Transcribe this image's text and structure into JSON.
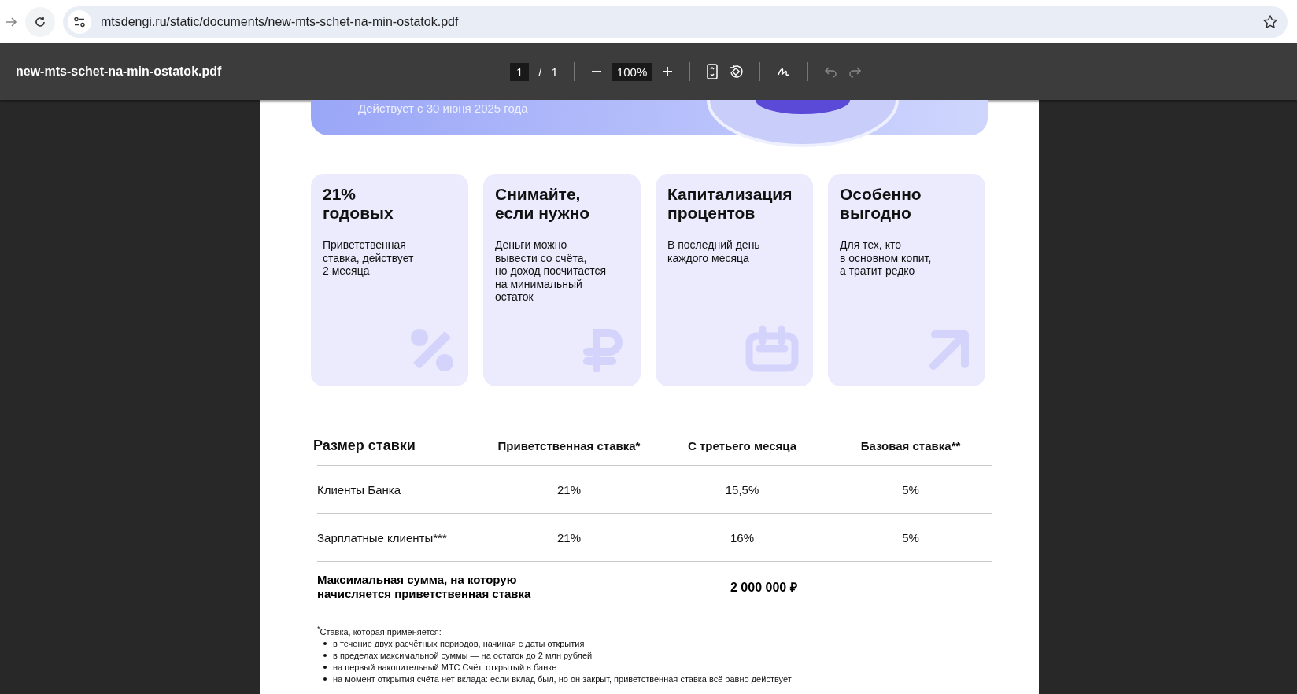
{
  "browser": {
    "url": "mtsdengi.ru/static/documents/new-mts-schet-na-min-ostatok.pdf"
  },
  "pdf_toolbar": {
    "title": "new-mts-schet-na-min-ostatok.pdf",
    "page": "1",
    "page_separator": "/",
    "page_count": "1",
    "zoom": "100%"
  },
  "banner": {
    "subtitle": "Действует с 30 июня 2025 года"
  },
  "cards": [
    {
      "kind": "percent",
      "title": "21%\nгодовых",
      "text": "Приветственная\nставка, действует\n2 месяца"
    },
    {
      "kind": "ruble",
      "title": "Снимайте,\nесли нужно",
      "text": "Деньги можно\nвывести со счёта,\nно доход посчитается\nна минимальный\nостаток"
    },
    {
      "kind": "calendar",
      "title": "Капитализация\nпроцентов",
      "text": "В последний день\nкаждого месяца"
    },
    {
      "kind": "arrow",
      "title": "Особенно\nвыгодно",
      "text": "Для тех, кто\nв основном копит,\nа тратит редко"
    }
  ],
  "table": {
    "columns": [
      "Размер ставки",
      "Приветственная ставка*",
      "С третьего месяца",
      "Базовая ставка**"
    ],
    "rows": [
      [
        "Клиенты Банка",
        "21%",
        "15,5%",
        "5%"
      ],
      [
        "Зарплатные клиенты***",
        "21%",
        "16%",
        "5%"
      ]
    ],
    "max_sum": {
      "label": "Максимальная сумма, на которую\nначисляется приветственная ставка",
      "value": "2 000 000 ₽"
    }
  },
  "footnote": {
    "title": "$^{*}$Ставка, которая применяется:",
    "items": [
      "в течение двух расчётных периодов, начиная с даты открытия",
      "в пределах максимальной суммы — на остаток до 2 млн рублей",
      "на первый накопительный МТС Счёт, открытый в банке",
      "на момент открытия счёта нет вклада: если вклад был, но он закрыт, приветственная ставка всё равно действует"
    ]
  }
}
